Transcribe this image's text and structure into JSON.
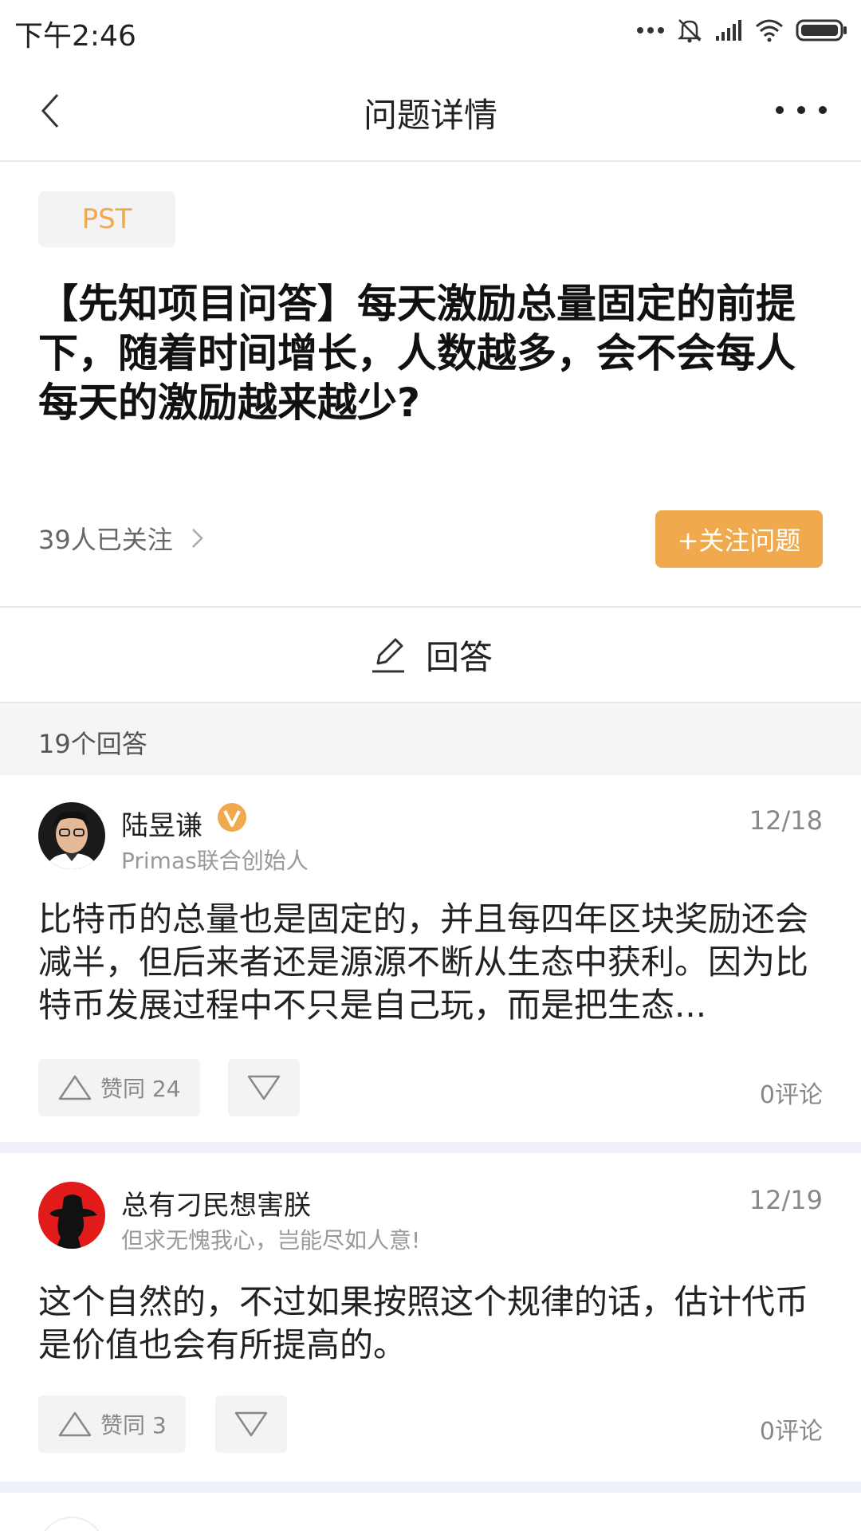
{
  "status_bar": {
    "time": "下午2:46",
    "icons": [
      "more-dots-icon",
      "mute-icon",
      "signal-icon",
      "wifi-icon",
      "battery-icon"
    ]
  },
  "nav": {
    "title": "问题详情",
    "back_icon": "chevron-left-icon",
    "more_icon": "more-horizontal-icon"
  },
  "question": {
    "tag": "PST",
    "title": "【先知项目问答】每天激励总量固定的前提下，随着时间增长，人数越多，会不会每人每天的激励越来越少?",
    "followers": "39人已关注",
    "follow_button": "+关注问题",
    "answer_button": "回答",
    "answer_count": "19个回答"
  },
  "answers": [
    {
      "author": "陆昱谦",
      "verified": true,
      "subtitle": "Primas联合创始人",
      "date": "12/18",
      "text": "比特币的总量也是固定的，并且每四年区块奖励还会减半，但后来者还是源源不断从生态中获利。因为比特币发展过程中不只是自己玩，而是把生态...",
      "upvote": "赞同 24",
      "comments": "0评论"
    },
    {
      "author": "总有刁民想害朕",
      "verified": false,
      "subtitle": "但求无愧我心，岂能尽如人意!",
      "date": "12/19",
      "text": "这个自然的，不过如果按照这个规律的话，估计代币是价值也会有所提高的。",
      "upvote": "赞同 3",
      "comments": "0评论"
    }
  ],
  "colors": {
    "accent": "#f0a94c",
    "band": "#eef2f8",
    "muted": "#888888"
  }
}
